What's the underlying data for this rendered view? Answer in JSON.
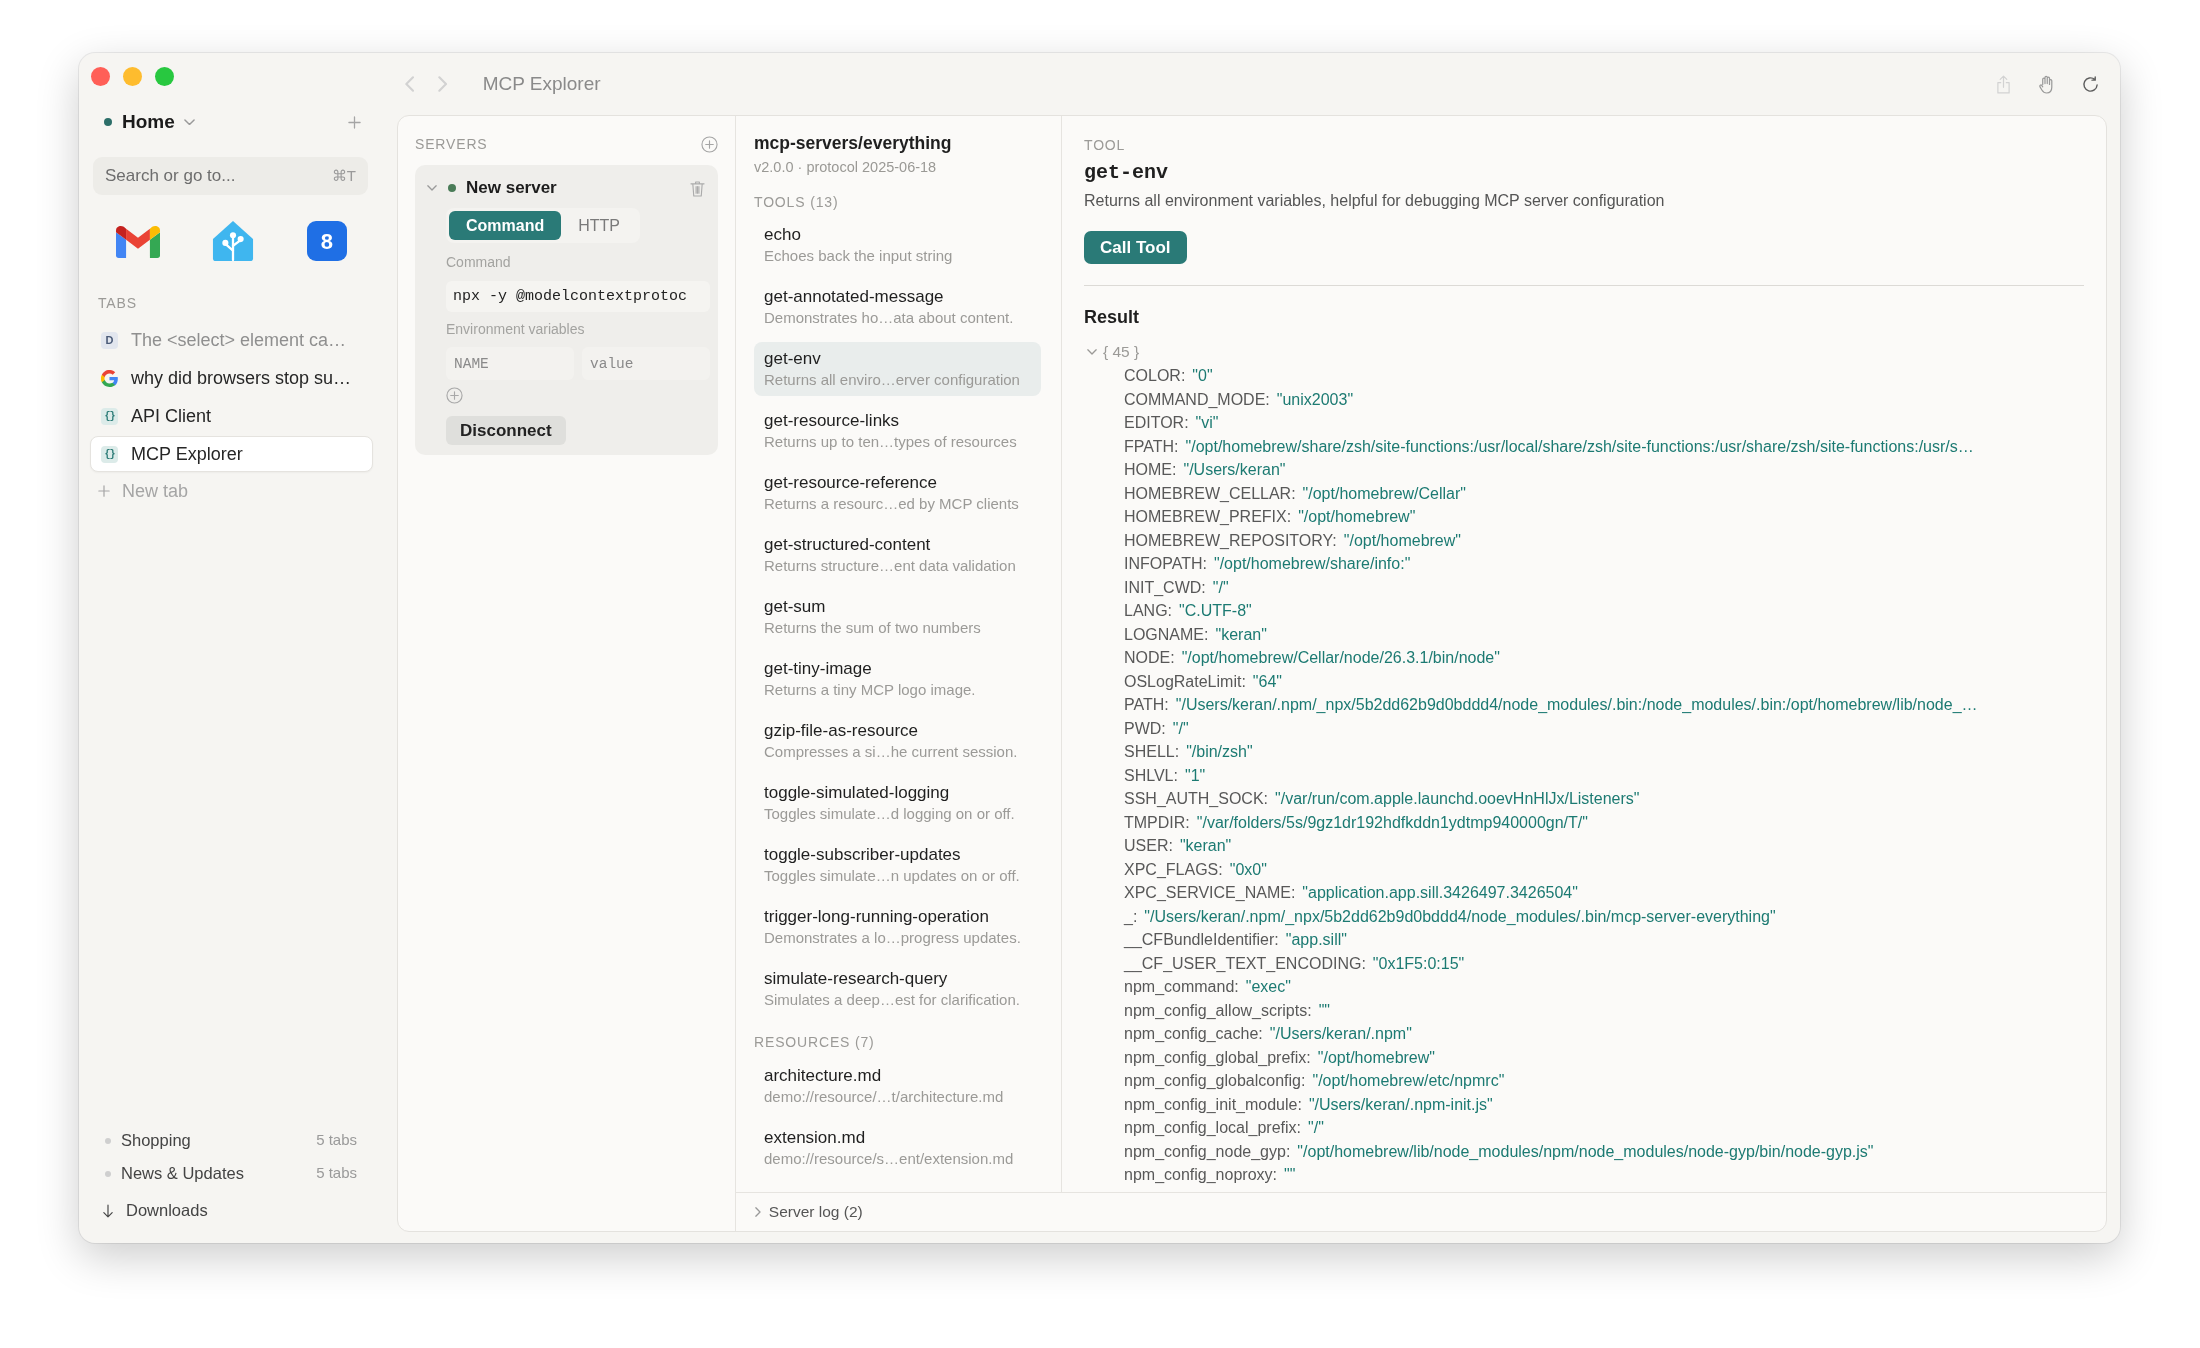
{
  "window": {
    "title": "MCP Explorer"
  },
  "navigation": [
    {
      "kind": "back",
      "disabled": true
    },
    {
      "kind": "forward",
      "disabled": true
    }
  ],
  "toolbar": [
    {
      "kind": "share",
      "disabled": true
    },
    {
      "kind": "hand",
      "disabled": false
    },
    {
      "kind": "reload",
      "disabled": false
    }
  ],
  "sidebar": {
    "space": {
      "name": "Home"
    },
    "search": {
      "placeholder": "Search or go to...",
      "shortcut": "⌘T"
    },
    "pinned": [
      {
        "kind": "m-logo"
      },
      {
        "kind": "house"
      },
      {
        "kind": "number",
        "label": "8"
      }
    ],
    "tabs_heading": "TABS",
    "tabs": [
      {
        "title": "The <select> element ca…",
        "kind": "letter",
        "icon_text": "D",
        "sleeping": true,
        "selected": false
      },
      {
        "title": "why did browsers stop su…",
        "kind": "g-logo",
        "sleeping": false,
        "selected": false
      },
      {
        "title": "API Client",
        "kind": "braces",
        "icon_text": "{}",
        "sleeping": false,
        "selected": false
      },
      {
        "title": "MCP Explorer",
        "kind": "braces",
        "icon_text": "{}",
        "sleeping": false,
        "selected": true
      }
    ],
    "new_tab": "New tab",
    "groups": [
      {
        "name": "Shopping",
        "count": "5 tabs"
      },
      {
        "name": "News & Updates",
        "count": "5 tabs"
      }
    ],
    "downloads": "Downloads"
  },
  "servers_panel": {
    "heading": "SERVERS",
    "servers": [
      {
        "name": "New server",
        "expanded": true,
        "connected": true,
        "transport": [
          {
            "label": "Command",
            "selected": true
          },
          {
            "label": "HTTP",
            "selected": false
          }
        ],
        "command_label": "Command",
        "command": {
          "value": "npx -y @modelcontextprotoc"
        },
        "env_label": "Environment variables",
        "env_rows": [
          {
            "name": {
              "placeholder": "NAME"
            },
            "value": {
              "placeholder": "value"
            }
          }
        ],
        "action": "Disconnect"
      }
    ]
  },
  "server_info": {
    "name": "mcp-servers/everything",
    "meta": "v2.0.0 · protocol 2025-06-18"
  },
  "tools": {
    "heading": "TOOLS (13)",
    "items": [
      {
        "name": "echo",
        "description": "Echoes back the input string",
        "selected": false
      },
      {
        "name": "get-annotated-message",
        "description": "Demonstrates ho…ata about content.",
        "selected": false
      },
      {
        "name": "get-env",
        "description": "Returns all enviro…erver configuration",
        "selected": true
      },
      {
        "name": "get-resource-links",
        "description": "Returns up to ten…types of resources",
        "selected": false
      },
      {
        "name": "get-resource-reference",
        "description": "Returns a resourc…ed by MCP clients",
        "selected": false
      },
      {
        "name": "get-structured-content",
        "description": "Returns structure…ent data validation",
        "selected": false
      },
      {
        "name": "get-sum",
        "description": "Returns the sum of two numbers",
        "selected": false
      },
      {
        "name": "get-tiny-image",
        "description": "Returns a tiny MCP logo image.",
        "selected": false
      },
      {
        "name": "gzip-file-as-resource",
        "description": "Compresses a si…he current session.",
        "selected": false
      },
      {
        "name": "toggle-simulated-logging",
        "description": "Toggles simulate…d logging on or off.",
        "selected": false
      },
      {
        "name": "toggle-subscriber-updates",
        "description": "Toggles simulate…n updates on or off.",
        "selected": false
      },
      {
        "name": "trigger-long-running-operation",
        "description": "Demonstrates a lo…progress updates.",
        "selected": false
      },
      {
        "name": "simulate-research-query",
        "description": "Simulates a deep…est for clarification.",
        "selected": false
      }
    ]
  },
  "resources": {
    "heading": "RESOURCES (7)",
    "items": [
      {
        "name": "architecture.md",
        "uri": "demo://resource/…t/architecture.md",
        "selected": false
      },
      {
        "name": "extension.md",
        "uri": "demo://resource/s…ent/extension.md",
        "selected": false
      }
    ]
  },
  "server_log": {
    "label": "Server log (2)",
    "expanded": false
  },
  "detail": {
    "section": "TOOL",
    "name": "get-env",
    "description": "Returns all environment variables, helpful for debugging MCP server configuration",
    "button": "Call Tool",
    "result_heading": "Result",
    "tree": {
      "summary": "{ 45 }",
      "expanded": true,
      "entries": [
        {
          "key": "COLOR:",
          "value": "\"0\""
        },
        {
          "key": "COMMAND_MODE:",
          "value": "\"unix2003\""
        },
        {
          "key": "EDITOR:",
          "value": "\"vi\""
        },
        {
          "key": "FPATH:",
          "value": "\"/opt/homebrew/share/zsh/site-functions:/usr/local/share/zsh/site-functions:/usr/share/zsh/site-functions:/usr/s…"
        },
        {
          "key": "HOME:",
          "value": "\"/Users/keran\""
        },
        {
          "key": "HOMEBREW_CELLAR:",
          "value": "\"/opt/homebrew/Cellar\""
        },
        {
          "key": "HOMEBREW_PREFIX:",
          "value": "\"/opt/homebrew\""
        },
        {
          "key": "HOMEBREW_REPOSITORY:",
          "value": "\"/opt/homebrew\""
        },
        {
          "key": "INFOPATH:",
          "value": "\"/opt/homebrew/share/info:\""
        },
        {
          "key": "INIT_CWD:",
          "value": "\"/\""
        },
        {
          "key": "LANG:",
          "value": "\"C.UTF-8\""
        },
        {
          "key": "LOGNAME:",
          "value": "\"keran\""
        },
        {
          "key": "NODE:",
          "value": "\"/opt/homebrew/Cellar/node/26.3.1/bin/node\""
        },
        {
          "key": "OSLogRateLimit:",
          "value": "\"64\""
        },
        {
          "key": "PATH:",
          "value": "\"/Users/keran/.npm/_npx/5b2dd62b9d0bddd4/node_modules/.bin:/node_modules/.bin:/opt/homebrew/lib/node_…"
        },
        {
          "key": "PWD:",
          "value": "\"/\""
        },
        {
          "key": "SHELL:",
          "value": "\"/bin/zsh\""
        },
        {
          "key": "SHLVL:",
          "value": "\"1\""
        },
        {
          "key": "SSH_AUTH_SOCK:",
          "value": "\"/var/run/com.apple.launchd.ooevHnHlJx/Listeners\""
        },
        {
          "key": "TMPDIR:",
          "value": "\"/var/folders/5s/9gz1dr192hdfkddn1ydtmp940000gn/T/\""
        },
        {
          "key": "USER:",
          "value": "\"keran\""
        },
        {
          "key": "XPC_FLAGS:",
          "value": "\"0x0\""
        },
        {
          "key": "XPC_SERVICE_NAME:",
          "value": "\"application.app.sill.3426497.3426504\""
        },
        {
          "key": "_:",
          "value": "\"/Users/keran/.npm/_npx/5b2dd62b9d0bddd4/node_modules/.bin/mcp-server-everything\""
        },
        {
          "key": "__CFBundleIdentifier:",
          "value": "\"app.sill\""
        },
        {
          "key": "__CF_USER_TEXT_ENCODING:",
          "value": "\"0x1F5:0:15\""
        },
        {
          "key": "npm_command:",
          "value": "\"exec\""
        },
        {
          "key": "npm_config_allow_scripts:",
          "value": "\"\""
        },
        {
          "key": "npm_config_cache:",
          "value": "\"/Users/keran/.npm\""
        },
        {
          "key": "npm_config_global_prefix:",
          "value": "\"/opt/homebrew\""
        },
        {
          "key": "npm_config_globalconfig:",
          "value": "\"/opt/homebrew/etc/npmrc\""
        },
        {
          "key": "npm_config_init_module:",
          "value": "\"/Users/keran/.npm-init.js\""
        },
        {
          "key": "npm_config_local_prefix:",
          "value": "\"/\""
        },
        {
          "key": "npm_config_node_gyp:",
          "value": "\"/opt/homebrew/lib/node_modules/npm/node_modules/node-gyp/bin/node-gyp.js\""
        },
        {
          "key": "npm_config_noproxy:",
          "value": "\"\""
        }
      ]
    }
  }
}
